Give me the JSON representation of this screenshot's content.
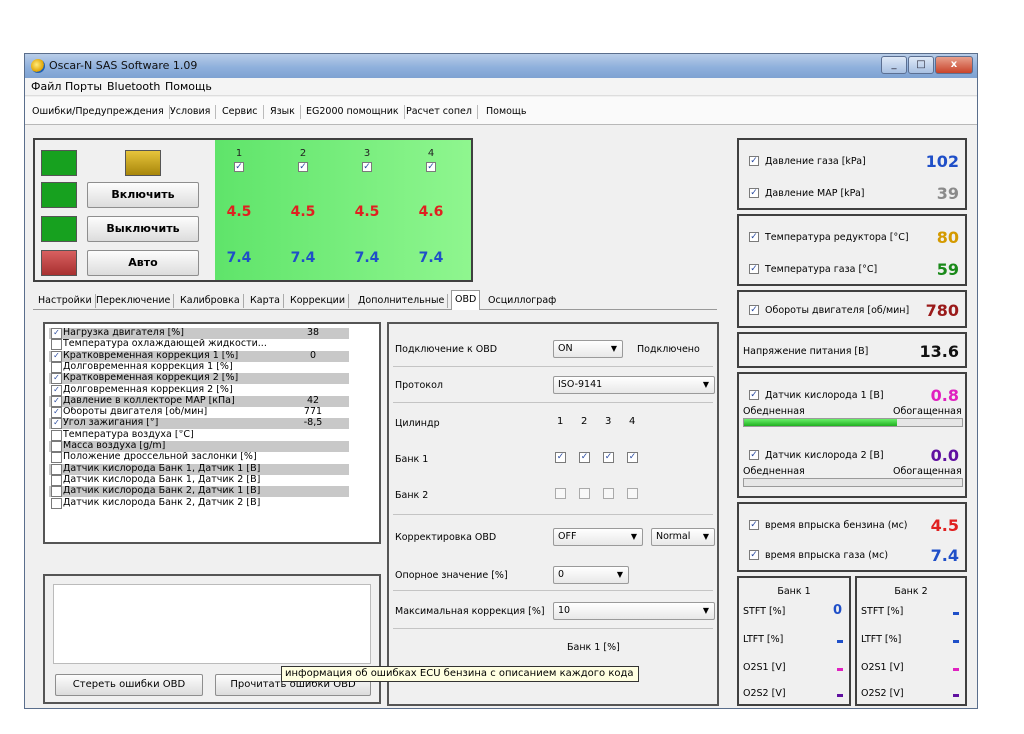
{
  "window": {
    "title": "Oscar-N SAS Software 1.09",
    "controls": {
      "minimize": "_",
      "maximize": "□",
      "close": "x"
    }
  },
  "menu": [
    "Файл",
    "Порты",
    "Bluetooth",
    "Помощь"
  ],
  "top_tabs": [
    "Ошибки/Предупреждения",
    "Условия",
    "Сервис",
    "Язык",
    "EG2000 помощник",
    "Расчет сопел",
    "Помощь"
  ],
  "status": {
    "buttons": {
      "on": "Включить",
      "off": "Выключить",
      "auto": "Авто"
    },
    "leds": {
      "led1": "#17a11f",
      "led2": "#c9a418",
      "led3": "#17a11f",
      "led4": "#17a11f",
      "led5": "#c64444"
    },
    "cylinders": [
      "1",
      "2",
      "3",
      "4"
    ],
    "gasoline_ms": [
      "4.5",
      "4.5",
      "4.5",
      "4.6"
    ],
    "gas_ms": [
      "7.4",
      "7.4",
      "7.4",
      "7.4"
    ],
    "check": "✓"
  },
  "main_tabs": [
    "Настройки",
    "Переключение",
    "Калибровка",
    "Карта",
    "Коррекции",
    "Дополнительные",
    "OBD",
    "Осциллограф"
  ],
  "obd_params": [
    {
      "label": "Нагрузка двигателя [%]",
      "value": "38",
      "checked": true
    },
    {
      "label": "Температура охлаждающей жидкости...",
      "value": "",
      "checked": false
    },
    {
      "label": "Кратковременная коррекция 1 [%]",
      "value": "0",
      "checked": true
    },
    {
      "label": "Долговременная коррекция 1 [%]",
      "value": "",
      "checked": false
    },
    {
      "label": "Кратковременная коррекция 2 [%]",
      "value": "",
      "checked": true
    },
    {
      "label": "Долговременная коррекция 2 [%]",
      "value": "",
      "checked": true
    },
    {
      "label": "Давление в коллекторе MAP [кПа]",
      "value": "42",
      "checked": true
    },
    {
      "label": "Обороты двигателя [об/мин]",
      "value": "771",
      "checked": true
    },
    {
      "label": "Угол зажигания [°]",
      "value": "-8,5",
      "checked": true
    },
    {
      "label": "Температура воздуха [°C]",
      "value": "",
      "checked": false
    },
    {
      "label": "Масса воздуха [g/m]",
      "value": "",
      "checked": false
    },
    {
      "label": "Положение дроссельной заслонки [%]",
      "value": "",
      "checked": false
    },
    {
      "label": "Датчик кислорода Банк 1, Датчик 1 [В]",
      "value": "",
      "checked": false
    },
    {
      "label": "Датчик кислорода Банк 1, Датчик 2 [В]",
      "value": "",
      "checked": false
    },
    {
      "label": "Датчик кислорода Банк 2, Датчик 1 [В]",
      "value": "",
      "checked": false
    },
    {
      "label": "Датчик кислорода Банк 2, Датчик 2 [В]",
      "value": "",
      "checked": false
    }
  ],
  "errors": {
    "clear_button": "Стереть ошибки OBD",
    "read_button": "Прочитать ошибки OBD",
    "tooltip": "информация об ошибках ECU бензина с описанием каждого кода"
  },
  "obd_settings": {
    "connection_label": "Подключение к OBD",
    "connection_value": "ON",
    "connection_status": "Подключено",
    "protocol_label": "Протокол",
    "protocol_value": "ISO-9141",
    "cylinder_label": "Цилиндр",
    "cylinders": [
      "1",
      "2",
      "3",
      "4"
    ],
    "bank1_label": "Банк 1",
    "bank2_label": "Банк 2",
    "correction_label": "Корректировка OBD",
    "correction_value": "OFF",
    "correction_mode": "Normal",
    "reference_label": "Опорное значение  [%]",
    "reference_value": "0",
    "maxcorr_label": "Максимальная коррекция  [%]",
    "maxcorr_value": "10",
    "bank1_pct": "Банк 1 [%]"
  },
  "readouts": {
    "gas_pressure": {
      "label": "Давление газа [kPa]",
      "value": "102",
      "color": "#1f4fc8"
    },
    "map_pressure": {
      "label": "Давление MAP [kPa]",
      "value": "39",
      "color": "#8a8a8a"
    },
    "reducer_temp": {
      "label": "Температура редуктора [°C]",
      "value": "80",
      "color": "#d49a00"
    },
    "gas_temp": {
      "label": "Температура газа [°C]",
      "value": "59",
      "color": "#1a8a1a"
    },
    "rpm": {
      "label": "Обороты двигателя [об/мин]",
      "value": "780",
      "color": "#9a1a1a"
    },
    "voltage": {
      "label": "Напряжение питания [В]",
      "value": "13.6",
      "color": "#111111"
    },
    "o2_1": {
      "label": "Датчик кислорода 1 [В]",
      "value": "0.8",
      "color": "#e020c0",
      "lean": "Обедненная",
      "rich": "Обогащенная",
      "level": 0.7
    },
    "o2_2": {
      "label": "Датчик кислорода 2 [В]",
      "value": "0.0",
      "color": "#6010a0",
      "lean": "Обедненная",
      "rich": "Обогащенная",
      "level": 0.0
    },
    "inj_petrol": {
      "label": "время впрыска бензина (мс)",
      "value": "4.5",
      "color": "#e02020"
    },
    "inj_gas": {
      "label": "время впрыска газа (мс)",
      "value": "7.4",
      "color": "#1f4fc8"
    }
  },
  "banks": {
    "bank1": {
      "title": "Банк 1",
      "rows": [
        "STFT [%]",
        "LTFT [%]",
        "O2S1 [V]",
        "O2S2 [V]"
      ],
      "stft_value": "0"
    },
    "bank2": {
      "title": "Банк 2",
      "rows": [
        "STFT [%]",
        "LTFT [%]",
        "O2S1 [V]",
        "O2S2 [V]"
      ]
    },
    "dash_colors": [
      "#1f4fc8",
      "#1f4fc8",
      "#e020c0",
      "#6010a0"
    ]
  }
}
